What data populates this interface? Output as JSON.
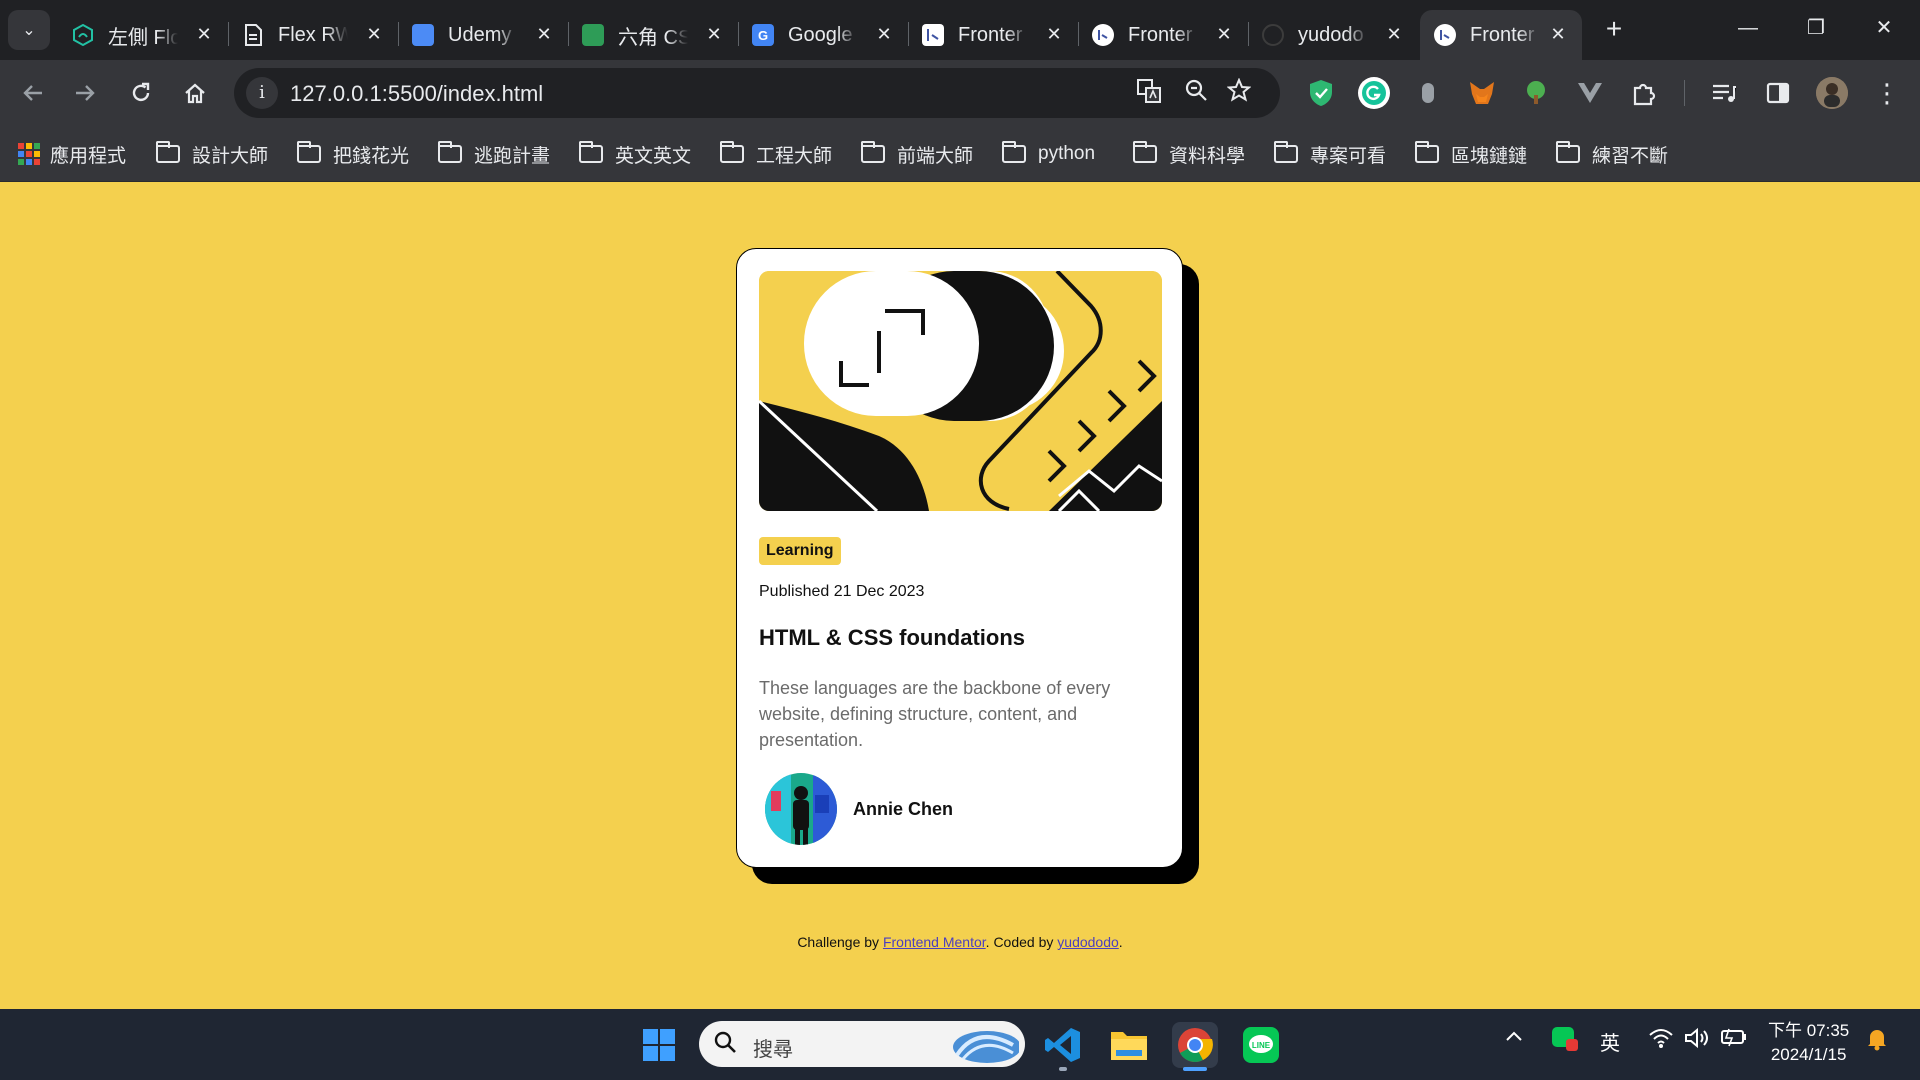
{
  "browser": {
    "tabs": [
      {
        "title": "左側 Flo",
        "favicon": "hex-green-icon",
        "color": "#22c1a4"
      },
      {
        "title": "Flex RW",
        "favicon": "document-icon",
        "color": "#e8eaed"
      },
      {
        "title": "Udemy",
        "favicon": "udemy-book-icon",
        "color": "#4c8bf5"
      },
      {
        "title": "六角 CS",
        "favicon": "green-book-icon",
        "color": "#2e9c57"
      },
      {
        "title": "Google",
        "favicon": "google-translate-icon",
        "color": "#4285f4"
      },
      {
        "title": "Fronter",
        "favicon": "frontend-mentor-icon",
        "color": "#ffffff"
      },
      {
        "title": "Fronter",
        "favicon": "frontend-mentor-circle-icon",
        "color": "#ffffff"
      },
      {
        "title": "yudodo",
        "favicon": "github-icon",
        "color": "#202124"
      },
      {
        "title": "Fronter",
        "favicon": "frontend-mentor-circle-icon",
        "color": "#ffffff",
        "active": true
      }
    ],
    "close_glyph": "✕",
    "new_tab_glyph": "+",
    "window_controls": {
      "minimize": "—",
      "restore": "❐",
      "close": "✕"
    },
    "address": "127.0.0.1:5500/index.html",
    "bookmarks": {
      "apps": "應用程式",
      "folders": [
        "設計大師",
        "把錢花光",
        "逃跑計畫",
        "英文英文",
        "工程大師",
        "前端大師",
        "python",
        "資料科學",
        "專案可看",
        "區塊鏈鏈",
        "練習不斷"
      ]
    },
    "extension_badge": "off"
  },
  "page": {
    "tag": "Learning",
    "published": "Published 21 Dec 2023",
    "title": "HTML & CSS foundations",
    "description": "These languages are the backbone of every website, defining structure, content, and presentation.",
    "author": "Annie Chen",
    "attribution": {
      "prefix": "Challenge by ",
      "link1": "Frontend Mentor",
      "middle": ". Coded by ",
      "link2": "yudododo",
      "suffix": "."
    },
    "colors": {
      "background": "#f4d04e",
      "card": "#ffffff",
      "text": "#111111",
      "muted": "#6b6b6b",
      "link": "#4b3fbf"
    }
  },
  "taskbar": {
    "search_placeholder": "搜尋",
    "tray_ime": "英",
    "clock_time": "下午 07:35",
    "clock_date": "2024/1/15"
  }
}
